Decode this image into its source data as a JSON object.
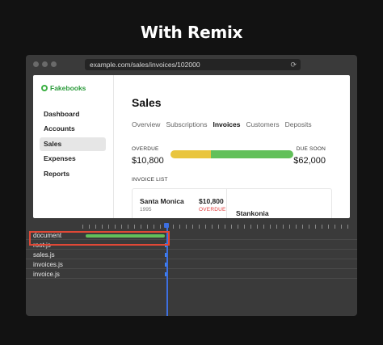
{
  "headline": "With Remix",
  "browser": {
    "url": "example.com/sales/invoices/102000"
  },
  "app": {
    "brand": "Fakebooks",
    "nav": [
      {
        "label": "Dashboard",
        "active": false
      },
      {
        "label": "Accounts",
        "active": false
      },
      {
        "label": "Sales",
        "active": true
      },
      {
        "label": "Expenses",
        "active": false
      },
      {
        "label": "Reports",
        "active": false
      }
    ],
    "page_title": "Sales",
    "tabs": [
      {
        "label": "Overview",
        "active": false
      },
      {
        "label": "Subscriptions",
        "active": false
      },
      {
        "label": "Invoices",
        "active": true
      },
      {
        "label": "Customers",
        "active": false
      },
      {
        "label": "Deposits",
        "active": false
      }
    ],
    "summary": {
      "overdue_label": "OVERDUE",
      "overdue_amount": "$10,800",
      "due_label": "DUE SOON",
      "due_amount": "$62,000",
      "overdue_fraction": 0.33,
      "overdue_color": "#e9c53e",
      "due_color": "#62c05a"
    },
    "invoice_list_label": "INVOICE LIST",
    "invoice": {
      "name": "Santa Monica",
      "year": "1995",
      "amount": "$10,800",
      "status": "OVERDUE",
      "detail_name": "Stankonia"
    }
  },
  "network": {
    "rows": [
      {
        "label": "document",
        "bar_start": 0.18,
        "bar_end": 0.42,
        "color": "#62c05a"
      },
      {
        "label": "root.js",
        "dot": 0.42
      },
      {
        "label": "sales.js",
        "dot": 0.42
      },
      {
        "label": "invoices.js",
        "dot": 0.42
      },
      {
        "label": "invoice.js",
        "dot": 0.42
      }
    ],
    "cursor_color": "#3d6fe0",
    "highlight_color": "#e04836"
  }
}
